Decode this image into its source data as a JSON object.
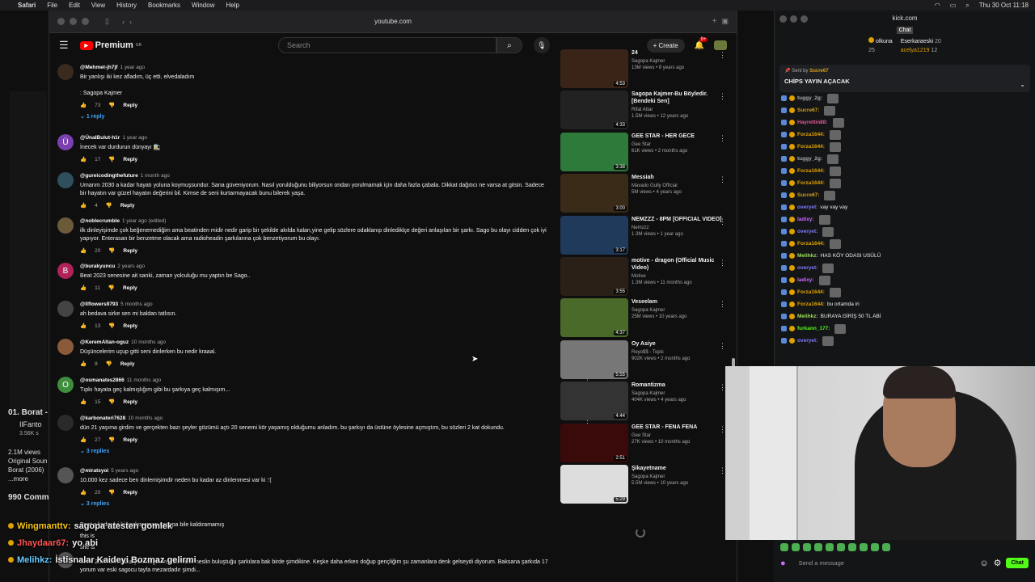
{
  "menubar": {
    "apple": "",
    "items": [
      "Safari",
      "File",
      "Edit",
      "View",
      "History",
      "Bookmarks",
      "Window",
      "Help"
    ],
    "clock": "Thu 30 Oct  11:18"
  },
  "safari": {
    "url": "youtube.com"
  },
  "youtube": {
    "logo_text": "Premium",
    "logo_region": "GB",
    "search_placeholder": "Search",
    "create_label": "Create",
    "notif_badge": "9+"
  },
  "comments": [
    {
      "author": "@Mehmet-jh7jf",
      "ago": "1 year ago",
      "avatar": "",
      "text": "Bir yanlışı iki kez afladım, üç etti, elvedaladım\n\n: Sagopa Kajmer",
      "likes": "73",
      "replies": "1 reply",
      "avatar_color": "#3a2a1f"
    },
    {
      "author": "@ÜnalBulut-h1r",
      "ago": "1 year ago",
      "avatar": "Ü",
      "text": "İnecek var durdurun dünyayı 🚉",
      "likes": "17",
      "replies": "",
      "avatar_color": "#7b3fb0"
    },
    {
      "author": "@gureicodingthefuture",
      "ago": "1 month ago",
      "avatar": "",
      "text": "Umarım 2030 a kadar hayatı yoluna koymuşsundur. Sana güveniyorum. Nasıl yorulduğunu biliyorsun ondan yorulmamak için daha fazla çabala. Dikkat dağıtıcı ne varsa at gitsin. Sadece bir hayatın var güzel hayatın değerini bil. Kimse de seni kurtarmayacak bunu bilerek yaşa.",
      "likes": "4",
      "replies": "",
      "avatar_color": "#2f4f5f"
    },
    {
      "author": "@noblecrumble",
      "ago": "1 year ago (edited)",
      "avatar": "",
      "text": "ilk dinleyişimde çok beğenemediğim ama beatinden midir nedir garip bir şekilde akılda kalan,yine gelip sözlere odaklanıp dinlediklçe değeri anlaşılan bir şarkı. Sago bu olayı cidden çok iyi yapıyor. Enterasan bir benzetme olacak ama radioheadin şarkılarına çok benzetiyorum bu olayı.",
      "likes": "20",
      "replies": "",
      "avatar_color": "#6b5a3a"
    },
    {
      "author": "@burakyuncu",
      "ago": "2 years ago",
      "avatar": "B",
      "text": "Beat 2023 senesine ait sanki, zaman yolculuğu mu yaptın be Sago..",
      "likes": "11",
      "replies": "",
      "avatar_color": "#b0235a"
    },
    {
      "author": "@Ilflowers9793",
      "ago": "5 months ago",
      "avatar": "",
      "text": "ah bedava sirke sen mi baldan tatlısın.",
      "likes": "13",
      "replies": "",
      "avatar_color": "#444"
    },
    {
      "author": "@KeremAltan-oguz",
      "ago": "10 months ago",
      "avatar": "",
      "text": "Düşüncelerim uçup gitti seni dinlerken bu nedir kraaal.",
      "likes": "8",
      "replies": "",
      "avatar_color": "#8a5a3a"
    },
    {
      "author": "@osmanates2866",
      "ago": "11 months ago",
      "avatar": "O",
      "text": "Tıpkı hayata geç kalmışlığım gibi bu şarkıya geç kalmışım...",
      "likes": "15",
      "replies": "",
      "avatar_color": "#3e8e3e"
    },
    {
      "author": "@karbonateri7628",
      "ago": "10 months ago",
      "avatar": "",
      "text": "dün 21 yaşıma girdim ve gerçekten bazı şeyler gözümü açtı 20 senemi kör yaşamış olduğumu anladım. bu şarkıyı da üstüne öylesine açmıştım, bu sözleri 2 kat dokundu.",
      "likes": "27",
      "replies": "3 replies",
      "avatar_color": "#2a2a2a"
    },
    {
      "author": "@miratsyoi",
      "ago": "5 years ago",
      "avatar": "",
      "text": "10.000 kez sadece ben dinlemişimdir neden bu kadar az dinlenmesi var ki :'(",
      "likes": "20",
      "replies": "3 replies",
      "avatar_color": "#555"
    }
  ],
  "partial_comments": [
    {
      "text": "Beat o kadar iyi ki koskocaman sagopa bile kaldıramamış"
    },
    {
      "text": "this is"
    },
    {
      "text": "she is"
    },
    {
      "author": "",
      "avatar": "H",
      "text": "Sene 2005 ben daha yeni doğdum o zamanki neslin buluştuğu şarkılara bak birde şimdikine. Keşke daha erken doğup gençliğim şu zamanlara denk gelseydi diyorum. Baksana şarkıda 17 yorum var eski sagocu tayfa mezardadır şimdi..."
    }
  ],
  "related": [
    {
      "title": "24",
      "channel": "Sagopa Kajmer",
      "meta": "13M views • 8 years ago",
      "dur": "4:53",
      "color": "#3a2418"
    },
    {
      "title": "Sagopa Kajmer-Bu Böyledir. [Bendeki Sen]",
      "channel": "Rifat Attar",
      "meta": "1.5M views • 12 years ago",
      "dur": "4:33",
      "color": "#222"
    },
    {
      "title": "GEE STAR - HER GECE",
      "channel": "Gee Star",
      "meta": "61K views • 2 months ago",
      "dur": "3:38",
      "color": "#2e7a3a"
    },
    {
      "title": "Messiah",
      "channel": "Mavado Gully Official",
      "meta": "5M views • 4 years ago",
      "dur": "3:00",
      "color": "#3a2a18"
    },
    {
      "title": "NEMZZZ - 8PM [OFFICIAL VIDEO]",
      "channel": "Nemzzz",
      "meta": "1.3M views • 1 year ago",
      "dur": "3:17",
      "color": "#1f3a5a"
    },
    {
      "title": "motive - dragon (Official Music Video)",
      "channel": "Motive",
      "meta": "1.3M views • 11 months ago",
      "dur": "3:55",
      "color": "#2a2018"
    },
    {
      "title": "Veseelam",
      "channel": "Sagopa Kajmer",
      "meta": "25M views • 10 years ago",
      "dur": "4:37",
      "color": "#4a6a2a"
    },
    {
      "title": "Oy Asiye",
      "channel": "Reyo$$ - Topic",
      "meta": "902K views • 2 months ago",
      "dur": "5:55",
      "color": "#777"
    },
    {
      "title": "Romantizma",
      "channel": "Sagopa Kajmer",
      "meta": "404K views • 4 years ago",
      "dur": "4:44",
      "color": "#333"
    },
    {
      "title": "GEE STAR - FENA FENA",
      "channel": "Gee Star",
      "meta": "27K views • 10 months ago",
      "dur": "2:51",
      "color": "#3a0a0a"
    },
    {
      "title": "Şikayetname",
      "channel": "Sagopa Kajmer",
      "meta": "5.5M views • 10 years ago",
      "dur": "5:29",
      "color": "#ddd"
    }
  ],
  "overlay": [
    {
      "user": "Wingmanttv:",
      "text": "sagopa atesten gomlek",
      "color": "#f5c518"
    },
    {
      "user": "Jhaydaar67:",
      "text": "yo abi",
      "color": "#ff5555"
    },
    {
      "user": "Melihkz:",
      "text": "İstisnalar Kaideyi Bozmaz gelirmi",
      "color": "#6cf"
    }
  ],
  "bg_left": {
    "title": "01. Borat -",
    "channel": "IlFanto",
    "subs": "3.56K s",
    "views": "2.1M views",
    "line1": "Original Soun",
    "line2": "Borat (2006)",
    "more": "...more",
    "comments": "990 Comm"
  },
  "kick": {
    "url": "kick.com",
    "chat_label": "Chat",
    "top1_name": "olkuna",
    "top1_val": "25",
    "top2_name": "Eserkaraeski",
    "top2_val": "20",
    "top3_name": "acelya1219",
    "top3_val": "12",
    "pin_sent_by": "Sent by",
    "pin_user": "Sucre67",
    "pin_msg": "CHİPS YAYIN AÇACAK",
    "messages": [
      {
        "user": "tuggy_2g:",
        "text": "",
        "color": "#aaa"
      },
      {
        "user": "Sucre67:",
        "text": "",
        "color": "#d4a017"
      },
      {
        "user": "Hayrettin88:",
        "text": "",
        "color": "#e05a9a"
      },
      {
        "user": "Forza1644:",
        "text": "",
        "color": "#e0a100"
      },
      {
        "user": "Forza1644:",
        "text": "",
        "color": "#e0a100"
      },
      {
        "user": "tuggy_2g:",
        "text": "",
        "color": "#aaa"
      },
      {
        "user": "Forza1644:",
        "text": "",
        "color": "#e0a100"
      },
      {
        "user": "Forza1644:",
        "text": "",
        "color": "#e0a100"
      },
      {
        "user": "Sucre67:",
        "text": "",
        "color": "#d4a017"
      },
      {
        "user": "overyet:",
        "text": "vay vay vay",
        "color": "#7b7bff"
      },
      {
        "user": "ladixy:",
        "text": "",
        "color": "#c96bff"
      },
      {
        "user": "overyet:",
        "text": "",
        "color": "#7b7bff"
      },
      {
        "user": "Forza1644:",
        "text": "",
        "color": "#e0a100"
      },
      {
        "user": "Melihkz:",
        "text": "HAS KÖY ODASI USÜLÜ",
        "color": "#9be05a"
      },
      {
        "user": "overyet:",
        "text": "",
        "color": "#7b7bff"
      },
      {
        "user": "ladixy:",
        "text": "",
        "color": "#c96bff"
      },
      {
        "user": "Forza1644:",
        "text": "",
        "color": "#e0a100"
      },
      {
        "user": "Forza1644:",
        "text": "bu ortamda iri",
        "color": "#e0a100"
      },
      {
        "user": "Melihkz:",
        "text": "BURAYA GİRİŞ 50 TL ABİ",
        "color": "#9be05a"
      },
      {
        "user": "furkann_177:",
        "text": "",
        "color": "#53fc18"
      },
      {
        "user": "overyet:",
        "text": "",
        "color": "#7b7bff"
      }
    ],
    "send_placeholder": "Send a message",
    "chat_button": "Chat"
  }
}
